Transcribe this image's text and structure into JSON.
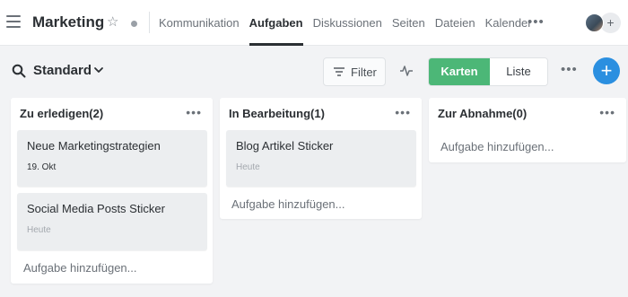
{
  "header": {
    "title": "Marketing",
    "tabs": [
      {
        "label": "Kommunikation",
        "active": false
      },
      {
        "label": "Aufgaben",
        "active": true
      },
      {
        "label": "Diskussionen",
        "active": false
      },
      {
        "label": "Seiten",
        "active": false
      },
      {
        "label": "Dateien",
        "active": false
      },
      {
        "label": "Kalender",
        "active": false
      }
    ],
    "more": "•••",
    "add_member": "+"
  },
  "toolbar": {
    "view_name": "Standard",
    "filter_label": "Filter",
    "view_cards": "Karten",
    "view_list": "Liste",
    "more": "•••",
    "add": "+"
  },
  "columns": [
    {
      "title": "Zu erledigen(2)",
      "cards": [
        {
          "title": "Neue Marketingstrategien",
          "date": "19. Okt"
        },
        {
          "title": "Social Media Posts Sticker",
          "date": "Heute"
        }
      ],
      "add_task": "Aufgabe hinzufügen..."
    },
    {
      "title": "In Bearbeitung(1)",
      "cards": [
        {
          "title": "Blog Artikel Sticker",
          "date": "Heute"
        }
      ],
      "add_task": "Aufgabe hinzufügen..."
    },
    {
      "title": "Zur Abnahme(0)",
      "cards": [],
      "add_task": "Aufgabe hinzufügen..."
    }
  ],
  "col_more": "•••",
  "colors": {
    "accent_green": "#4cb777",
    "accent_blue": "#2b8fe0",
    "background": "#f2f3f5"
  },
  "icons": [
    "menu-icon",
    "star-icon",
    "status-dot-icon",
    "search-icon",
    "chevron-down-icon",
    "filter-icon",
    "activity-icon",
    "more-icon",
    "plus-icon"
  ]
}
